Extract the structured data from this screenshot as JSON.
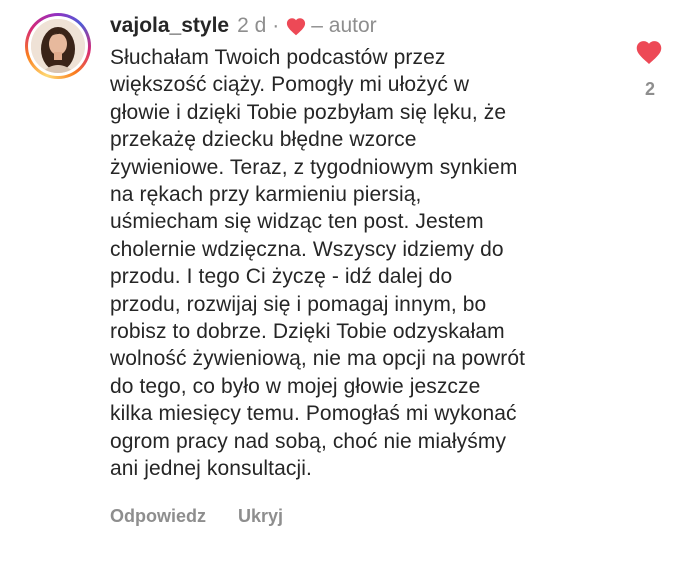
{
  "comment": {
    "username": "vajola_style",
    "time": "2 d",
    "separator": "·",
    "author_label": "– autor",
    "text": "Słuchałam Twoich podcastów przez\nwiększość ciąży. Pomogły mi ułożyć w\ngłowie i dzięki Tobie pozbyłam się lęku, że\nprzekażę dziecku błędne wzorce\nżywieniowe. Teraz, z tygodniowym synkiem\nna rękach przy karmieniu piersią,\nuśmiecham się widząc ten post. Jestem\ncholernie wdzięczna. Wszyscy idziemy do\nprzodu. I tego Ci życzę - idź dalej do\nprzodu, rozwijaj się i pomagaj innym, bo\nrobisz to dobrze. Dzięki Tobie odzyskałam\nwolność żywieniową, nie ma opcji na powrót\ndo tego, co było w mojej głowie jeszcze\nkilka miesięcy temu. Pomogłaś mi wykonać\nogrom pracy nad sobą, choć nie miałyśmy\nani jednej konsultacji.",
    "reply_label": "Odpowiedz",
    "hide_label": "Ukryj",
    "like_count": "2",
    "author_liked_icon": "heart-filled-icon",
    "like_icon": "heart-filled-icon"
  },
  "colors": {
    "heart": "#ed4956",
    "muted_text": "#8e8e8e",
    "primary_text": "#262626"
  }
}
